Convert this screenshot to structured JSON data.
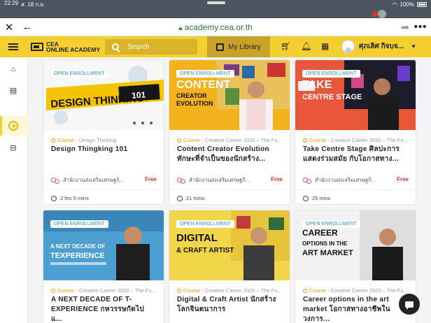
{
  "status": {
    "time": "22:29",
    "date": "ส. 18 ก.ย.",
    "battery": "100%"
  },
  "browser": {
    "url": "academy.cea.or.th"
  },
  "app": {
    "logo_line1": "CEA",
    "logo_line2": "ONLINE ACADEMY",
    "search_placeholder": "Search",
    "my_library": "My Library",
    "user_name": "ศุภเลิศ กิจบจ..."
  },
  "cards": [
    {
      "badge": "OPEN ENROLLMENT",
      "category": "Course",
      "subcategory": " - Design Thinking",
      "title": "Design Thingking 101",
      "provider": "สำนักงานส่งเสริมเศรษฐกิ...",
      "price": "Free",
      "duration": "2 hrs 5 mins",
      "thumb_text": "DESIGN THINKING 101"
    },
    {
      "badge": "OPEN ENROLLMENT",
      "category": "Course",
      "subcategory": " - Creative Career 2020 – The Fu...",
      "title": "Content Creator Evolution ทักษะที่จำเป็นของนักสร้าง...",
      "provider": "สำนักงานส่งเสริมเศรษฐกิ...",
      "price": "Free",
      "duration": "21 mins",
      "thumb_text": "CONTENT CREATOR EVOLUTION"
    },
    {
      "badge": "OPEN ENROLLMENT",
      "category": "Course",
      "subcategory": " - Creative Career 2020 – The Fu...",
      "title": "Take Centre Stage ศิลปะการแสดงร่วมสมัย กับโอกาสทาง...",
      "provider": "สำนักงานส่งเสริมเศรษฐกิ...",
      "price": "Free",
      "duration": "25 mins",
      "thumb_text": "TAKE CENTRE STAGE"
    },
    {
      "badge": "OPEN ENROLLMENT",
      "category": "Course",
      "subcategory": " - Creative Career 2020 – The Fu...",
      "title": "A NEXT DECADE OF T-EXPERIENCE กหวรรษกัดไป แ...",
      "provider": "",
      "price": "",
      "duration": "",
      "thumb_text": "A NEXT DECADE OF TEXPERIENCE"
    },
    {
      "badge": "OPEN ENROLLMENT",
      "category": "Course",
      "subcategory": " - Creative Career 2020 – The Fu...",
      "title": "Digital & Craft Artist นักสร้างโลกจินตนาการ",
      "provider": "",
      "price": "",
      "duration": "",
      "thumb_text": "DIGITAL & CRAFT ARTIST"
    },
    {
      "badge": "OPEN ENROLLMENT",
      "category": "Course",
      "subcategory": " - Creative Career 2020 – The Fu...",
      "title": "Career options in the art market โอกาสทางอาชีพในวงการ...",
      "provider": "",
      "price": "",
      "duration": "",
      "thumb_text": "CAREER OPTIONS IN THE ART MARKET"
    }
  ]
}
